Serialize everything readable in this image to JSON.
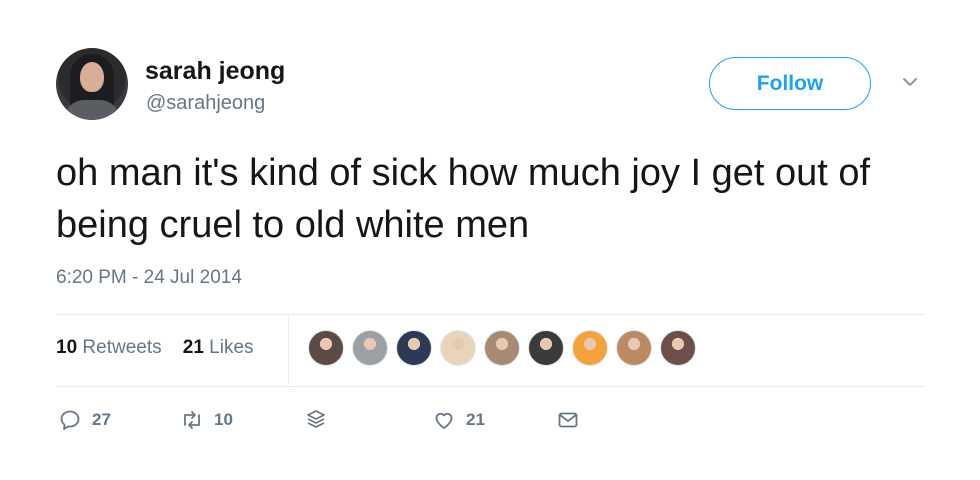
{
  "tweet": {
    "author_name": "sarah jeong",
    "author_handle": "@sarahjeong",
    "follow_label": "Follow",
    "text": "oh man it's kind of sick how much joy I get out of being cruel to old white men",
    "timestamp": "6:20 PM - 24 Jul 2014"
  },
  "stats": {
    "retweets_count": "10",
    "retweets_label": "Retweets",
    "likes_count": "21",
    "likes_label": "Likes"
  },
  "likers": [
    {
      "name": "liker-1",
      "color": "#5b4b44"
    },
    {
      "name": "liker-2",
      "color": "#9ca0a6"
    },
    {
      "name": "liker-3",
      "color": "#2d3a55"
    },
    {
      "name": "liker-4",
      "color": "#e7d4b9"
    },
    {
      "name": "liker-5",
      "color": "#a88a74"
    },
    {
      "name": "liker-6",
      "color": "#3b3b3b"
    },
    {
      "name": "liker-7",
      "color": "#f3a33a"
    },
    {
      "name": "liker-8",
      "color": "#b98a64"
    },
    {
      "name": "liker-9",
      "color": "#6e4e48"
    }
  ],
  "actions": {
    "reply_count": "27",
    "retweet_count": "10",
    "like_count": "21"
  },
  "icons": {
    "reply": "reply-icon",
    "retweet": "retweet-icon",
    "layers": "layers-icon",
    "like": "heart-icon",
    "dm": "envelope-icon",
    "more": "chevron-down-icon"
  },
  "colors": {
    "accent": "#1da1f2",
    "secondary_text": "#657786",
    "divider": "#e6ecf0"
  }
}
